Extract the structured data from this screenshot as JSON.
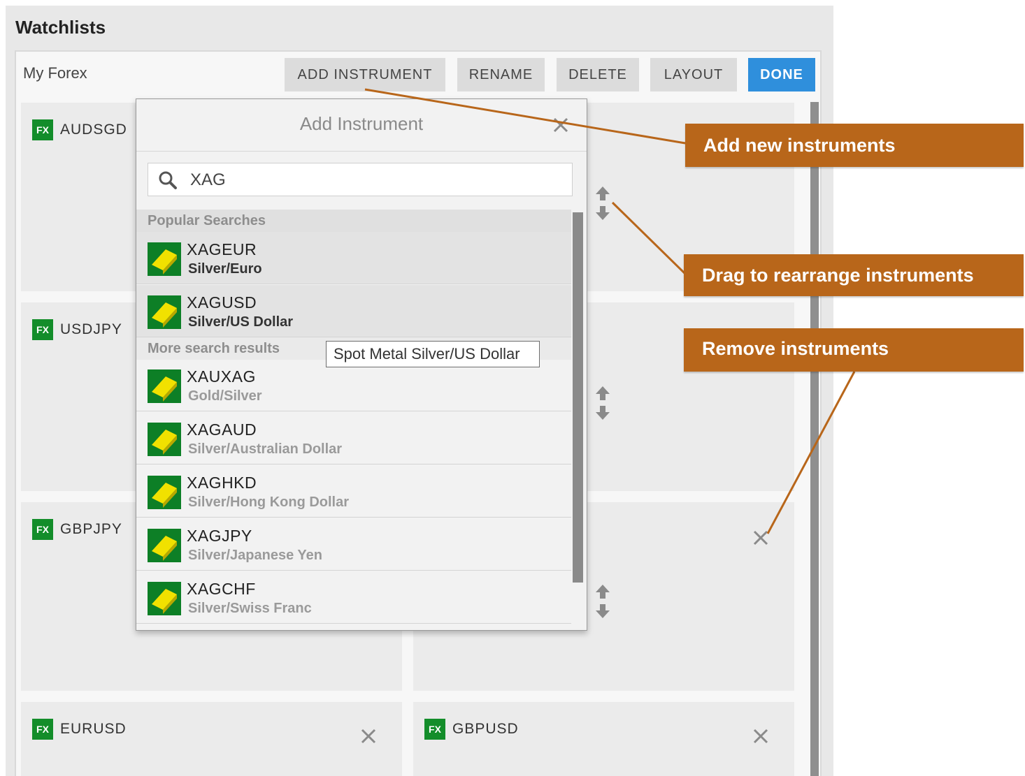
{
  "panel": {
    "title": "Watchlists"
  },
  "watchlist": {
    "name": "My Forex",
    "buttons": {
      "add_instrument": "ADD INSTRUMENT",
      "rename": "RENAME",
      "delete": "DELETE",
      "layout": "LAYOUT",
      "done": "DONE"
    },
    "tiles": [
      {
        "badge": "FX",
        "symbol": "AUDSGD"
      },
      {
        "badge": "FX",
        "symbol": "USDJPY"
      },
      {
        "badge": "FX",
        "symbol": "GBPJPY"
      },
      {
        "badge": "FX",
        "symbol": "EURUSD"
      },
      {
        "badge": "FX",
        "symbol": "GBPUSD"
      }
    ]
  },
  "dialog": {
    "title": "Add Instrument",
    "search_value": "XAG",
    "sections": {
      "popular": "Popular Searches",
      "more": "More search results"
    },
    "popular_results": [
      {
        "code": "XAGEUR",
        "desc": "Silver/Euro"
      },
      {
        "code": "XAGUSD",
        "desc": "Silver/US Dollar"
      }
    ],
    "more_results": [
      {
        "code": "XAUXAG",
        "desc": "Gold/Silver"
      },
      {
        "code": "XAGAUD",
        "desc": "Silver/Australian Dollar"
      },
      {
        "code": "XAGHKD",
        "desc": "Silver/Hong Kong Dollar"
      },
      {
        "code": "XAGJPY",
        "desc": "Silver/Japanese Yen"
      },
      {
        "code": "XAGCHF",
        "desc": "Silver/Swiss Franc"
      }
    ],
    "tooltip": "Spot Metal Silver/US Dollar"
  },
  "callouts": {
    "add": "Add new instruments",
    "drag": "Drag to rearrange instruments",
    "remove": "Remove instruments"
  },
  "colors": {
    "accent_blue": "#2f8fdc",
    "fx_green": "#138d2a",
    "metal_yellow": "#f1e100",
    "callout_orange": "#b8661a"
  },
  "icons": {
    "search": "search-icon",
    "close": "close-icon",
    "drag": "drag-handle-icon",
    "metal": "silver-bar-icon"
  }
}
